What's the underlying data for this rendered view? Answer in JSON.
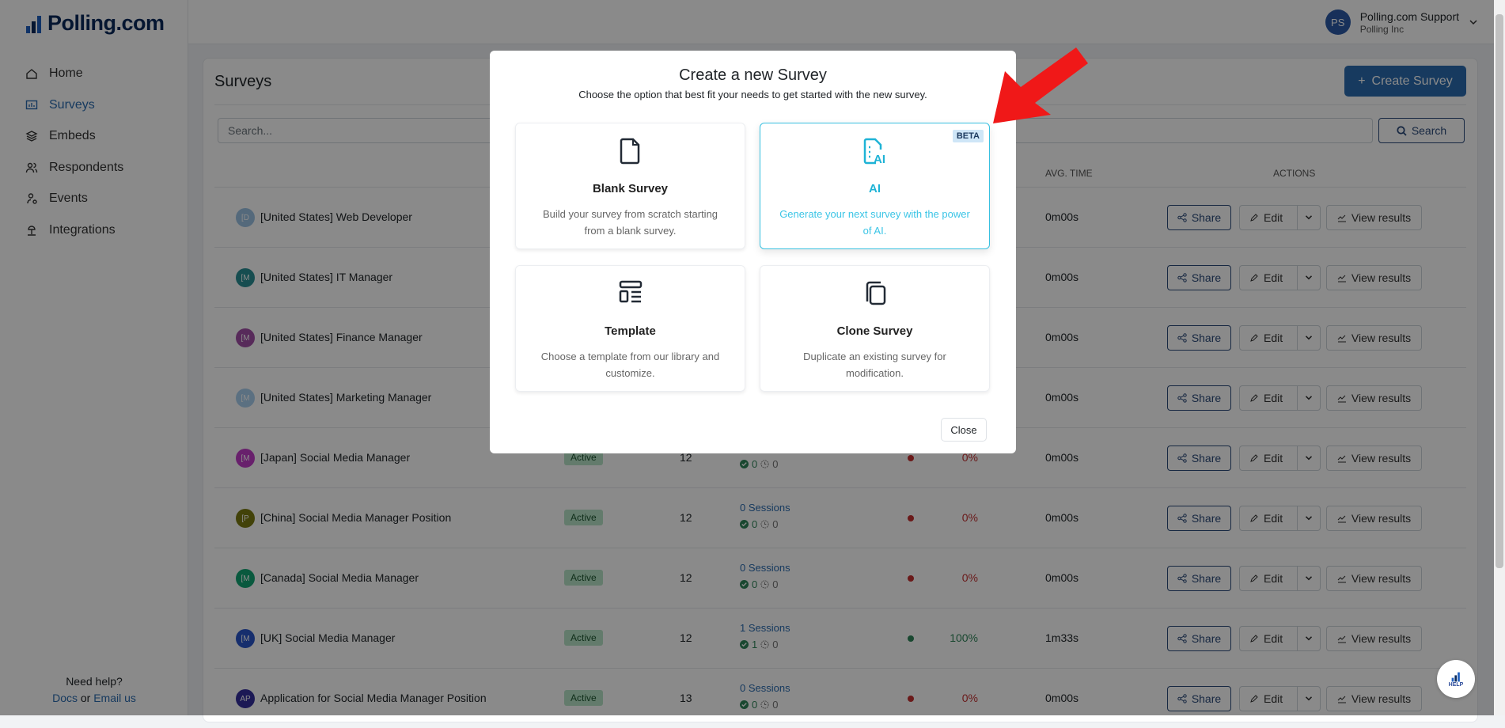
{
  "brand": {
    "name": "Polling.com"
  },
  "sidebar": {
    "items": [
      {
        "label": "Home",
        "icon": "home-icon"
      },
      {
        "label": "Surveys",
        "icon": "chart-icon",
        "active": true
      },
      {
        "label": "Embeds",
        "icon": "layers-icon"
      },
      {
        "label": "Respondents",
        "icon": "users-icon"
      },
      {
        "label": "Events",
        "icon": "user-event-icon"
      },
      {
        "label": "Integrations",
        "icon": "plug-icon"
      }
    ],
    "help": {
      "title": "Need help?",
      "docs": "Docs",
      "or": "or",
      "email": "Email us"
    }
  },
  "user": {
    "initials": "PS",
    "name": "Polling.com Support",
    "org": "Polling Inc"
  },
  "main": {
    "title": "Surveys",
    "create_label": "Create Survey",
    "search_placeholder": "Search...",
    "search_label": "Search",
    "headers": {
      "avg_time": "AVG. TIME",
      "actions": "ACTIONS"
    },
    "actions": {
      "share": "Share",
      "edit": "Edit",
      "view": "View results"
    },
    "rows": [
      {
        "initials": "[D",
        "color": "#9cc3e4",
        "name": "[United States] Web Developer",
        "avg": "0m00s"
      },
      {
        "initials": "[M",
        "color": "#2a8f94",
        "name": "[United States] IT Manager",
        "avg": "0m00s"
      },
      {
        "initials": "[M",
        "color": "#a24fa6",
        "name": "[United States] Finance Manager",
        "avg": "0m00s"
      },
      {
        "initials": "[M",
        "color": "#a9d0ef",
        "name": "[United States] Marketing Manager",
        "avg": "0m00s"
      },
      {
        "initials": "[M",
        "color": "#c13bc7",
        "name": "[Japan] Social Media Manager",
        "status": "Active",
        "count": "12",
        "completed": "0",
        "pending": "0",
        "dot": "#c53030",
        "pct": "0%",
        "avg": "0m00s"
      },
      {
        "initials": "[P",
        "color": "#7a7a12",
        "name": "[China] Social Media Manager Position",
        "status": "Active",
        "count": "12",
        "sessions": "0 Sessions",
        "completed": "0",
        "pending": "0",
        "dot": "#c53030",
        "pct": "0%",
        "avg": "0m00s"
      },
      {
        "initials": "[M",
        "color": "#12a574",
        "name": "[Canada] Social Media Manager",
        "status": "Active",
        "count": "12",
        "sessions": "0 Sessions",
        "completed": "0",
        "pending": "0",
        "dot": "#c53030",
        "pct": "0%",
        "avg": "0m00s"
      },
      {
        "initials": "[M",
        "color": "#2a55c9",
        "name": "[UK] Social Media Manager",
        "status": "Active",
        "count": "12",
        "sessions": "1 Sessions",
        "completed": "1",
        "pending": "0",
        "dot": "#2f855a",
        "pct": "100%",
        "avg": "1m33s"
      },
      {
        "initials": "AP",
        "color": "#352f9e",
        "name": "Application for Social Media Manager Position",
        "status": "Active",
        "count": "13",
        "sessions": "0 Sessions",
        "completed": "0",
        "pending": "0",
        "dot": "#c53030",
        "pct": "0%",
        "avg": "0m00s"
      }
    ]
  },
  "modal": {
    "title": "Create a new Survey",
    "subtitle": "Choose the option that best fit your needs to get started with the new survey.",
    "options": [
      {
        "title": "Blank Survey",
        "desc": "Build your survey from scratch starting from a blank survey.",
        "icon": "file-icon"
      },
      {
        "title": "AI",
        "desc": "Generate your next survey with the power of AI.",
        "icon": "ai-file-icon",
        "badge": "BETA",
        "selected": true
      },
      {
        "title": "Template",
        "desc": "Choose a template from our library and customize.",
        "icon": "template-icon"
      },
      {
        "title": "Clone Survey",
        "desc": "Duplicate an existing survey for modification.",
        "icon": "copy-icon"
      }
    ],
    "close_label": "Close"
  },
  "help_fab": {
    "label": "HELP"
  },
  "colors": {
    "accent": "#2b6cb0",
    "ai": "#1fb3d6",
    "annotation_arrow": "#f01818"
  }
}
